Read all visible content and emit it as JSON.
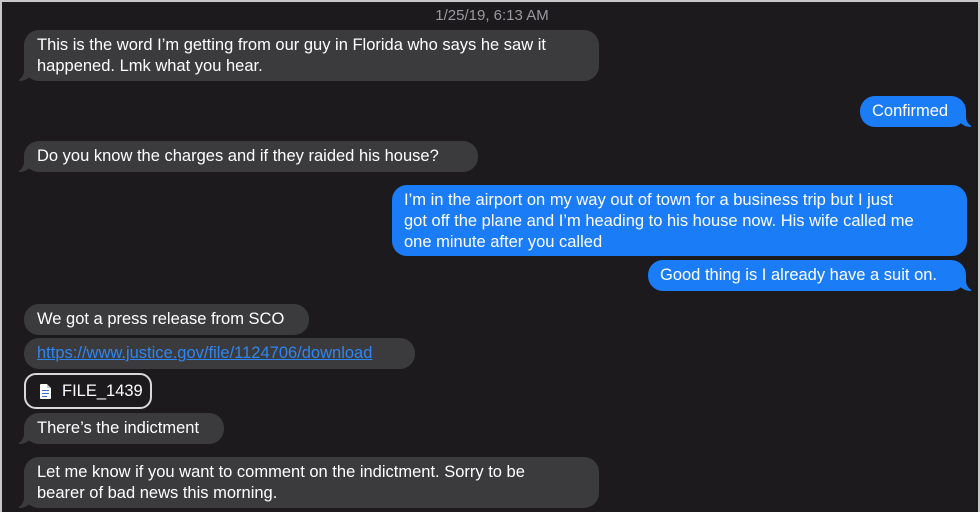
{
  "conversation": {
    "timestamp": "1/25/19, 6:13 AM",
    "messages": [
      {
        "direction": "incoming",
        "lines": [
          "This is the word I’m getting from our guy in Florida who says he saw it",
          "happened. Lmk what you hear."
        ]
      },
      {
        "direction": "outgoing",
        "lines": [
          "Confirmed"
        ]
      },
      {
        "direction": "incoming",
        "lines": [
          "Do you know the charges and if they raided his house?"
        ]
      },
      {
        "direction": "outgoing",
        "lines": [
          "I’m in the airport on my way out of town for a business trip but I just",
          "got off the plane and I’m heading to his house now. His wife called me",
          "one minute after you called"
        ]
      },
      {
        "direction": "outgoing",
        "lines": [
          "Good thing is I already have a suit on."
        ]
      },
      {
        "direction": "incoming",
        "lines": [
          "We got a press release from SCO"
        ]
      },
      {
        "direction": "incoming",
        "link": "https://www.justice.gov/file/1124706/download"
      },
      {
        "direction": "incoming",
        "attachment": {
          "icon": "document-icon",
          "name": "FILE_1439"
        }
      },
      {
        "direction": "incoming",
        "lines": [
          "There’s the indictment"
        ]
      },
      {
        "direction": "incoming",
        "lines": [
          "Let me know if you want to comment on the indictment. Sorry to be",
          "bearer of bad news this morning."
        ]
      }
    ]
  },
  "colors": {
    "background": "#1c1a1c",
    "incoming_bubble": "#3b3b3d",
    "outgoing_bubble": "#1a7cf7",
    "link": "#2f86f2",
    "timestamp": "#9a9a9e"
  }
}
